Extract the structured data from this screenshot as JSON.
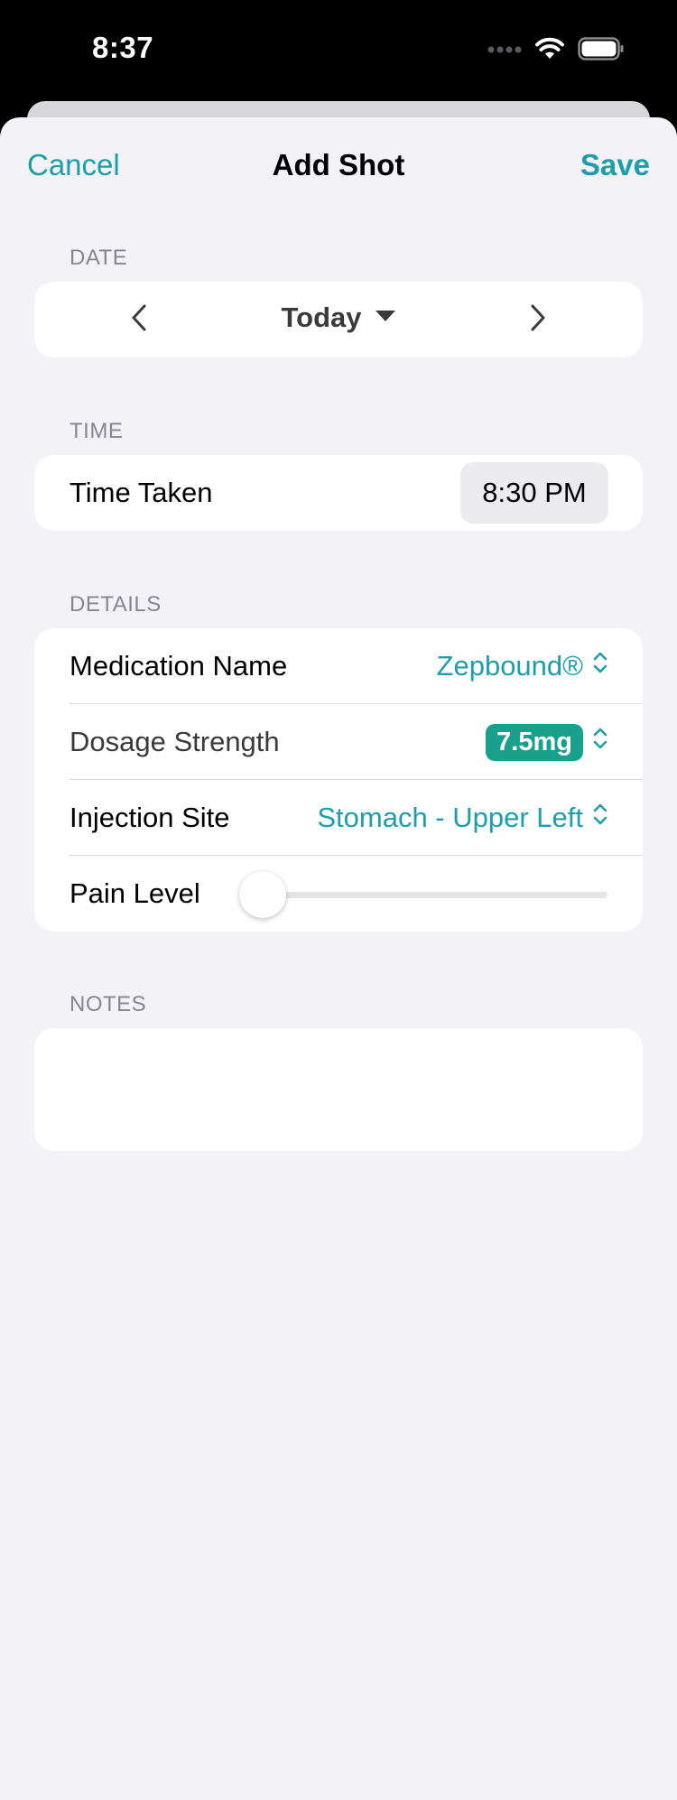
{
  "status_bar": {
    "time": "8:37",
    "icons": [
      "signal-dots-icon",
      "wifi-icon",
      "battery-icon"
    ]
  },
  "nav": {
    "cancel_label": "Cancel",
    "title": "Add Shot",
    "save_label": "Save"
  },
  "date_section": {
    "header": "DATE",
    "label": "Today"
  },
  "time_section": {
    "header": "TIME",
    "row_label": "Time Taken",
    "value": "8:30 PM"
  },
  "details_section": {
    "header": "DETAILS",
    "medication": {
      "label": "Medication Name",
      "value": "Zepbound®"
    },
    "dosage": {
      "label": "Dosage Strength",
      "value": "7.5mg"
    },
    "site": {
      "label": "Injection Site",
      "value": "Stomach - Upper Left"
    },
    "pain": {
      "label": "Pain Level",
      "level": 0
    }
  },
  "notes_section": {
    "header": "NOTES",
    "value": ""
  },
  "colors": {
    "accent": "#1d9eaa",
    "badge": "#19a08d",
    "background": "#f2f2f7"
  }
}
